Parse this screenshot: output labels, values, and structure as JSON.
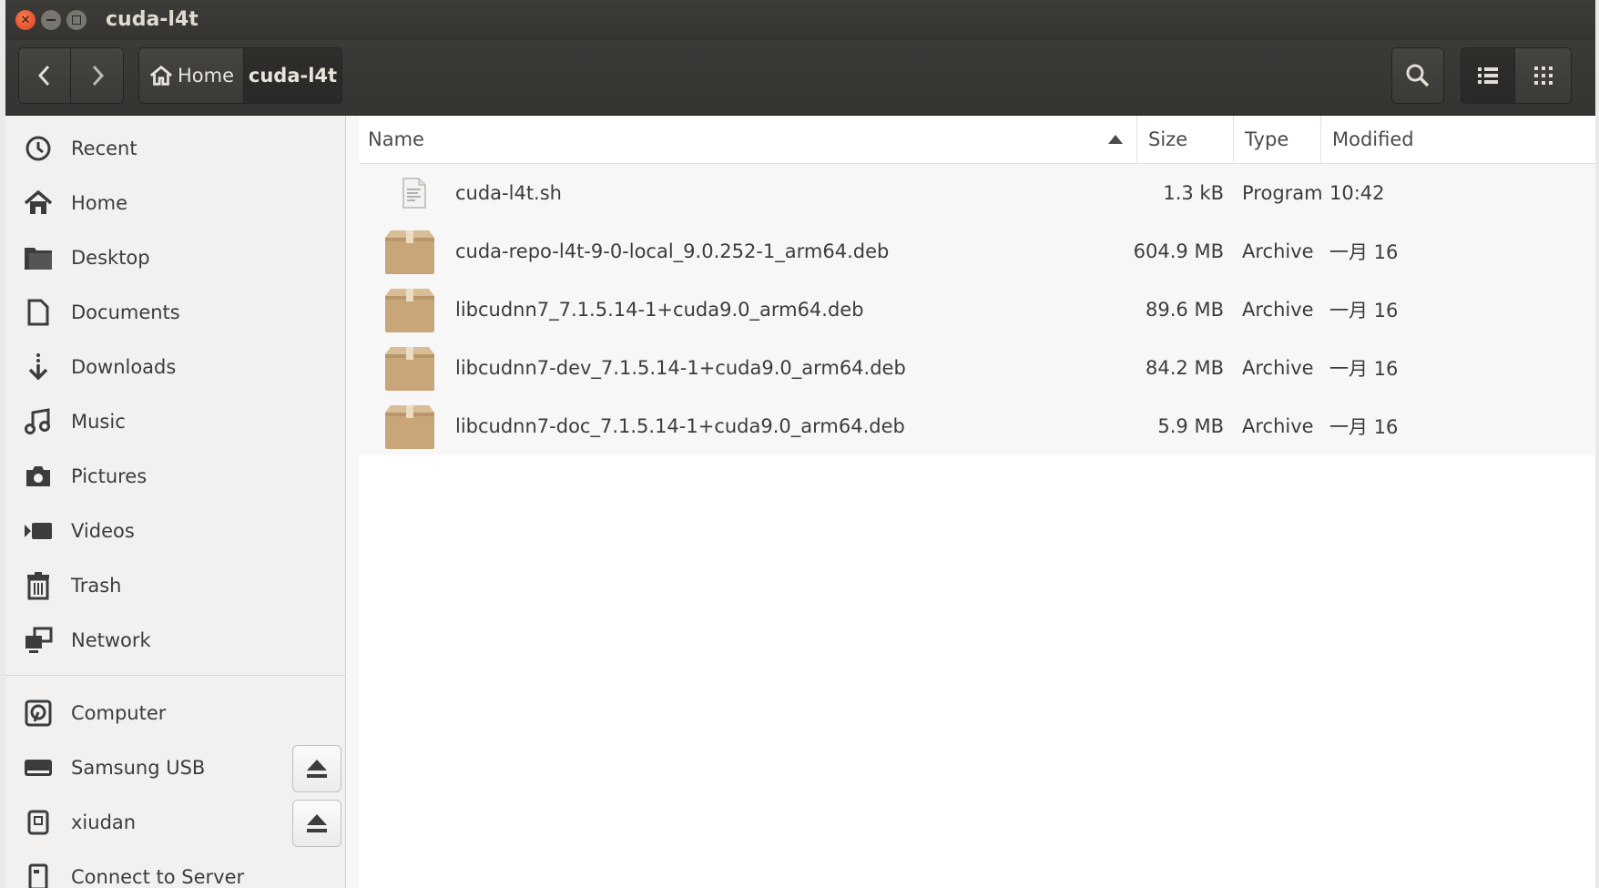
{
  "window": {
    "title": "cuda-l4t"
  },
  "header": {
    "back_icon": "chevron-left-icon",
    "forward_icon": "chevron-right-icon",
    "breadcrumbs": [
      {
        "label": "Home",
        "icon": "home-icon"
      },
      {
        "label": "cuda-l4t"
      }
    ],
    "search_icon": "search-icon",
    "list_view_icon": "list-view-icon",
    "grid_view_icon": "grid-view-icon"
  },
  "sidebar": {
    "items": [
      {
        "label": "Recent",
        "icon": "clock-icon"
      },
      {
        "label": "Home",
        "icon": "home-icon"
      },
      {
        "label": "Desktop",
        "icon": "folder-icon"
      },
      {
        "label": "Documents",
        "icon": "document-icon"
      },
      {
        "label": "Downloads",
        "icon": "download-icon"
      },
      {
        "label": "Music",
        "icon": "music-icon"
      },
      {
        "label": "Pictures",
        "icon": "camera-icon"
      },
      {
        "label": "Videos",
        "icon": "video-icon"
      },
      {
        "label": "Trash",
        "icon": "trash-icon"
      },
      {
        "label": "Network",
        "icon": "network-icon"
      }
    ],
    "devices": [
      {
        "label": "Computer",
        "icon": "harddisk-icon"
      },
      {
        "label": "Samsung USB",
        "icon": "drive-icon",
        "ejectable": true
      },
      {
        "label": "xiudan",
        "icon": "usb-drive-icon",
        "ejectable": true
      },
      {
        "label": "Connect to Server",
        "icon": "server-icon"
      }
    ]
  },
  "columns": {
    "name": "Name",
    "size": "Size",
    "type": "Type",
    "modified": "Modified",
    "sort_icon": "sort-ascending-icon"
  },
  "files": [
    {
      "name": "cuda-l4t.sh",
      "size": "1.3 kB",
      "type": "Program",
      "modified": "10:42",
      "icon": "script-file-icon"
    },
    {
      "name": "cuda-repo-l4t-9-0-local_9.0.252-1_arm64.deb",
      "size": "604.9 MB",
      "type": "Archive",
      "modified": "一月 16",
      "icon": "package-icon"
    },
    {
      "name": "libcudnn7_7.1.5.14-1+cuda9.0_arm64.deb",
      "size": "89.6 MB",
      "type": "Archive",
      "modified": "一月 16",
      "icon": "package-icon"
    },
    {
      "name": "libcudnn7-dev_7.1.5.14-1+cuda9.0_arm64.deb",
      "size": "84.2 MB",
      "type": "Archive",
      "modified": "一月 16",
      "icon": "package-icon"
    },
    {
      "name": "libcudnn7-doc_7.1.5.14-1+cuda9.0_arm64.deb",
      "size": "5.9 MB",
      "type": "Archive",
      "modified": "一月 16",
      "icon": "package-icon"
    }
  ],
  "colors": {
    "titlebar": "#3b3a37",
    "close_button": "#e9541f",
    "sidebar_bg": "#f2f1f0",
    "package_tan": "#c9a57a"
  }
}
